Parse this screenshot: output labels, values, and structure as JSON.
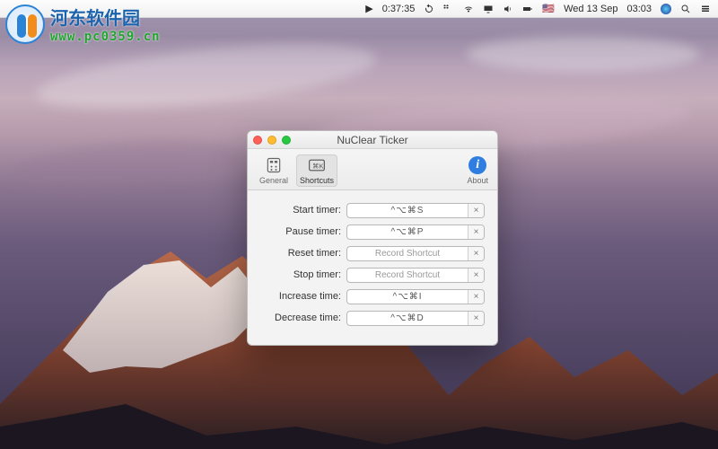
{
  "menubar": {
    "play_time": "0:37:35",
    "flag": "🇺🇸",
    "date": "Wed 13 Sep",
    "time": "03:03"
  },
  "watermark": {
    "line1": "河东软件园",
    "line2": "www.pc0359.cn"
  },
  "window": {
    "title": "NuClear Ticker",
    "tabs": {
      "general": "General",
      "shortcuts": "Shortcuts",
      "about": "About"
    },
    "placeholder": "Record Shortcut",
    "clear_symbol": "×",
    "rows": [
      {
        "label": "Start timer:",
        "value": "^⌥⌘S",
        "has_value": true
      },
      {
        "label": "Pause timer:",
        "value": "^⌥⌘P",
        "has_value": true
      },
      {
        "label": "Reset timer:",
        "value": "",
        "has_value": false
      },
      {
        "label": "Stop timer:",
        "value": "",
        "has_value": false
      },
      {
        "label": "Increase time:",
        "value": "^⌥⌘I",
        "has_value": true
      },
      {
        "label": "Decrease time:",
        "value": "^⌥⌘D",
        "has_value": true
      }
    ]
  }
}
